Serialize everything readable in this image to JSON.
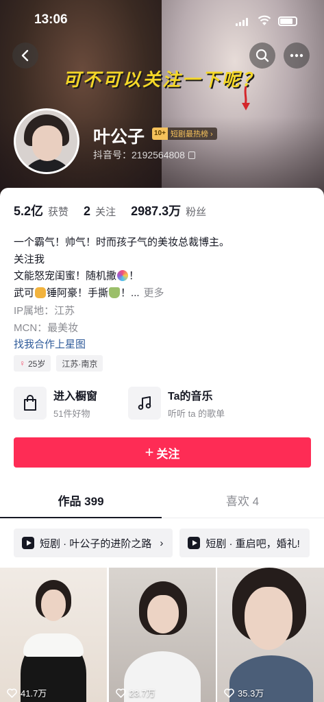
{
  "status_bar": {
    "time": "13:06"
  },
  "banner": {
    "caption": "可不可以关注一下呢？"
  },
  "profile": {
    "name": "叶公子",
    "rank_badge_num": "10+",
    "rank_badge_text": "短剧最热榜 ›",
    "douyin_id": "抖音号：2192564808"
  },
  "stats": [
    {
      "value": "5.2亿",
      "label": "获赞"
    },
    {
      "value": "2",
      "label": "关注"
    },
    {
      "value": "2987.3万",
      "label": "粉丝"
    }
  ],
  "bio": {
    "line1": "一个霸气！帅气！时而孩子气的美妆总裁博主。",
    "line2": "关注我",
    "line3_a": "文能怒宠闺蜜！随机撒",
    "line3_b": "！",
    "line4_a": "武可",
    "line4_b": "锤阿豪！手撕",
    "line4_c": "！...",
    "more": "更多"
  },
  "meta": {
    "ip": "IP属地：江苏",
    "mcn": "MCN：最美妆",
    "star_link": "找我合作上星图"
  },
  "tags": {
    "age": "25岁",
    "location": "江苏·南京"
  },
  "shortcuts": {
    "shop_title": "进入橱窗",
    "shop_sub": "51件好物",
    "music_title": "Ta的音乐",
    "music_sub": "听听 ta 的歌单"
  },
  "follow_button": {
    "plus": "+",
    "label": "关注"
  },
  "tabs": [
    {
      "label": "作品 399",
      "active": true
    },
    {
      "label": "喜欢 4",
      "active": false
    }
  ],
  "series": [
    {
      "label": "短剧 · 叶公子的进阶之路"
    },
    {
      "label": "短剧 · 重启吧，婚礼!"
    }
  ],
  "videos": [
    {
      "likes": "41.7万"
    },
    {
      "likes": "23.7万"
    },
    {
      "likes": "35.3万"
    }
  ],
  "colors": {
    "follow": "#fe2c55",
    "link": "#2f5b9a",
    "caption": "#f4d728",
    "badge": "#f5c15b"
  }
}
